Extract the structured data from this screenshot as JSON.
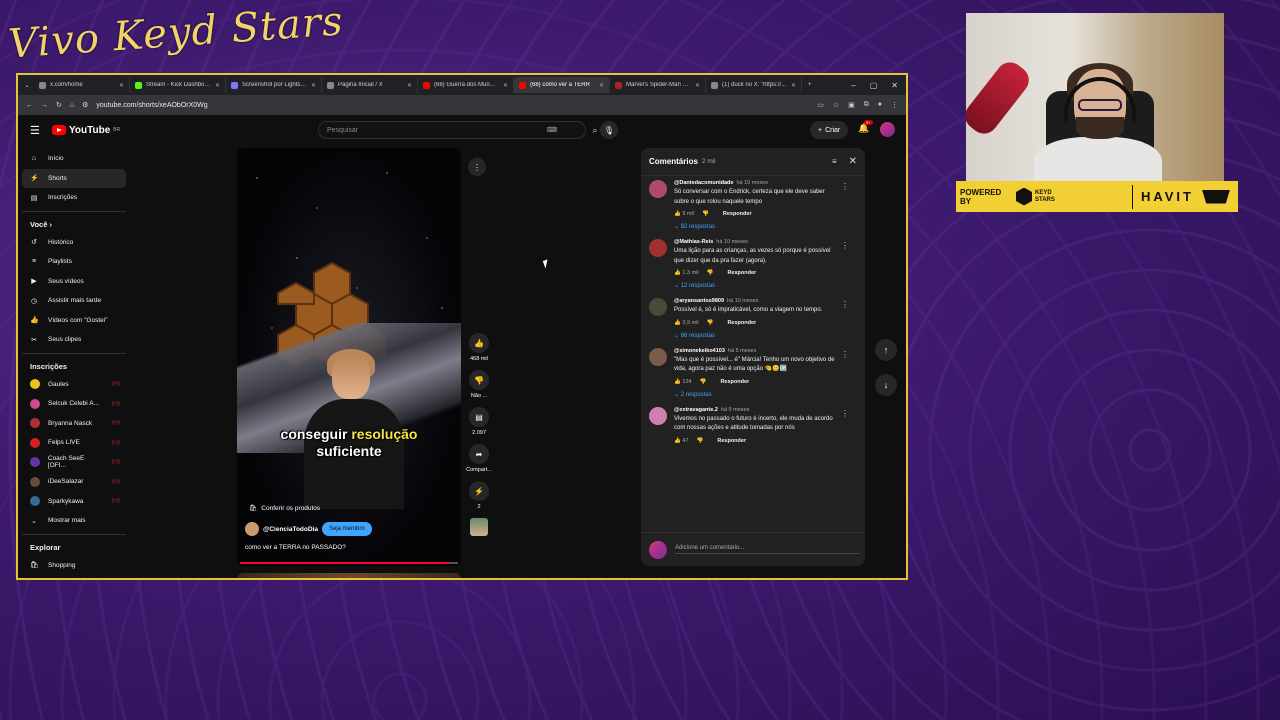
{
  "overlay": {
    "title": "Vivo Keyd Stars"
  },
  "browser": {
    "tabs": [
      {
        "label": "x.com/home",
        "color": "#888888"
      },
      {
        "label": "Stream - Kick Dashboard",
        "color": "#53fc18"
      },
      {
        "label": "Screenshot por Lightshot",
        "color": "#7a7aff"
      },
      {
        "label": "Página Inicial / X",
        "color": "#888888"
      },
      {
        "label": "(68) Guerra dos Mundos",
        "color": "#ff0000"
      },
      {
        "label": "(68) como ver a TERR",
        "color": "#ff0000",
        "active": true
      },
      {
        "label": "Marvel's Spider-Man Bra",
        "color": "#aa2222"
      },
      {
        "label": "(1) duck no X: \"https://...",
        "color": "#888888"
      }
    ],
    "url": "youtube.com/shorts/xeAObOrX0Wg"
  },
  "youtube": {
    "logo_text": "YouTube",
    "logo_country": "BR",
    "search_placeholder": "Pesquisar",
    "create_label": "Criar",
    "notif_count": "9+",
    "sidebar": {
      "main": [
        {
          "label": "Início",
          "icon": "home-icon",
          "glyph": "⌂"
        },
        {
          "label": "Shorts",
          "icon": "shorts-icon",
          "glyph": "⚡",
          "active": true
        },
        {
          "label": "Inscrições",
          "icon": "subscriptions-icon",
          "glyph": "▤"
        }
      ],
      "you_heading": "Você",
      "you_items": [
        {
          "label": "Histórico",
          "icon": "history-icon",
          "glyph": "↺"
        },
        {
          "label": "Playlists",
          "icon": "playlists-icon",
          "glyph": "≡"
        },
        {
          "label": "Seus vídeos",
          "icon": "your-videos-icon",
          "glyph": "▶"
        },
        {
          "label": "Assistir mais tarde",
          "icon": "watch-later-icon",
          "glyph": "◷"
        },
        {
          "label": "Vídeos com \"Gostei\"",
          "icon": "liked-icon",
          "glyph": "👍"
        },
        {
          "label": "Seus clipes",
          "icon": "clips-icon",
          "glyph": "✂"
        }
      ],
      "subs_heading": "Inscrições",
      "subs": [
        {
          "label": "Gaules",
          "color": "#e8c020"
        },
        {
          "label": "Selcuk Celebi A...",
          "color": "#d04a8a"
        },
        {
          "label": "Bryanna Nasck",
          "color": "#b0303a"
        },
        {
          "label": "Felps LIVE",
          "color": "#d02020"
        },
        {
          "label": "Coach SeeE [OFI...",
          "color": "#5a3aa0"
        },
        {
          "label": "iDeeSalazar",
          "color": "#6a4a3a"
        },
        {
          "label": "Sparkykawa",
          "color": "#3a6a9a"
        }
      ],
      "show_more": "Mostrar mais",
      "explore_heading": "Explorar",
      "explore_items": [
        {
          "label": "Shopping"
        }
      ]
    },
    "short": {
      "caption_pre": "conseguir ",
      "caption_hl": "resolução",
      "caption_post": "suficiente",
      "products_label": "Conferir os produtos",
      "channel": "@CienciaTodoDia",
      "member_label": "Seja membro",
      "title": "como ver a TERRA no PASSADO?",
      "progress": 0.96
    },
    "actions": {
      "likes": "468 mil",
      "dislike": "Não ...",
      "comments": "2.097",
      "share": "Compart...",
      "remix": "2"
    },
    "comments": {
      "title": "Comentários",
      "count": "2 mil",
      "add_placeholder": "Adicione um comentário...",
      "items": [
        {
          "author": "@Dantedacomunidade",
          "ago": "há 10 meses",
          "text": "Só conversar com o Endrick, certeza que ele deve saber sobre o que rolou naquele tempo",
          "likes": "9 mil",
          "reply": "Responder",
          "replies": "82 respostas",
          "color": "#b04a6a"
        },
        {
          "author": "@Mathias-Reis",
          "ago": "há 10 meses",
          "text": "Uma lição para as crianças, as vezes só porque é possível que dizer que da pra fazer (agora).",
          "likes": "1,3 mil",
          "reply": "Responder",
          "replies": "12 respostas",
          "color": "#a03030"
        },
        {
          "author": "@aryansantos9809",
          "ago": "há 10 meses",
          "text": "Possível é, só é impraticável, como a viagem no tempo.",
          "likes": "3,9 mil",
          "reply": "Responder",
          "replies": "66 respostas",
          "color": "#4a4a3a"
        },
        {
          "author": "@simonekeiko4103",
          "ago": "há 5 meses",
          "text": "\"Mas que é possível... é\" Márcia! Tenho um novo objetivo de vida, agora paz não é uma opção 🤏😊🆙",
          "likes": "124",
          "reply": "Responder",
          "replies": "2 respostas",
          "color": "#7a5a4a"
        },
        {
          "author": "@extravagante.2",
          "ago": "há 9 meses",
          "text": "Vivemos no passado o futuro é incerto, ele muda de acordo com nossas ações e atitude tomadas por nós",
          "likes": "47",
          "reply": "Responder",
          "replies": "",
          "color": "#d080b0"
        }
      ]
    }
  },
  "sponsor": {
    "powered_by": "POWERED BY",
    "keyd": "KEYD\nSTARS",
    "brand": "HAVIT"
  }
}
